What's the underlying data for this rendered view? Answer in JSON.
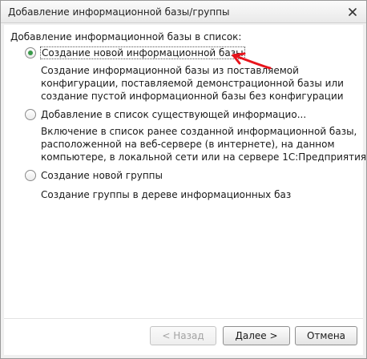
{
  "window": {
    "title": "Добавление информационной базы/группы"
  },
  "form": {
    "section_label": "Добавление информационной базы в список:",
    "options": [
      {
        "label": "Создание новой информационной базы",
        "checked": true,
        "description": [
          "Создание информационной базы из поставляемой",
          "конфигурации, поставляемой демонстрационной базы или",
          "создание пустой информационной базы без конфигурации"
        ]
      },
      {
        "label": "Добавление в список существующей информацио...",
        "checked": false,
        "description": [
          "Включение в список ранее созданной информационной базы,",
          "расположенной на веб-сервере (в интернете), на данном",
          "компьютере,  в локальной сети или на сервере 1С:Предприятия"
        ]
      },
      {
        "label": "Создание новой группы",
        "checked": false,
        "description": [
          "Создание группы в дереве информационных баз"
        ]
      }
    ]
  },
  "buttons": {
    "back": "< Назад",
    "next": "Далее >",
    "cancel": "Отмена"
  },
  "colors": {
    "radio_dot": "#3a9a4a",
    "arrow": "#e8141c"
  }
}
